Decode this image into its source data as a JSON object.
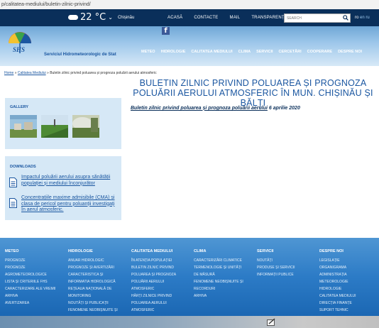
{
  "browser": {
    "url": "p/calitatea-mediului/buletin-zilnic-privind/"
  },
  "topbar": {
    "temperature": "22 °C",
    "chevron": "⌄",
    "city": "Chișinău",
    "links": [
      "ACASĂ",
      "CONTACTE",
      "MAIL",
      "TRANSPARENȚA"
    ],
    "search_placeholder": "SEARCH",
    "lang_active": "ro",
    "lang_other": "en ru"
  },
  "header": {
    "facebook": "f",
    "logo_text": "Serviciul Hidrometeorologic de Stat",
    "nav": [
      "METEO",
      "HIDROLOGIE",
      "CALITATEA MEDIULUI",
      "CLIMA",
      "SERVICII",
      "CERCETĂRI",
      "COOPERARE",
      "DESPRE NOI"
    ]
  },
  "breadcrumb": {
    "home": "Home",
    "sep1": " » ",
    "section": "Calitatea Mediului",
    "sep2": " » ",
    "current": "Buletin zilnic privind poluarea și prognoza poluării aerului atmosferic"
  },
  "main": {
    "title": "BULETIN ZILNIC PRIVIND POLUAREA ȘI PROGNOZA POLUĂRII AERULUI ATMOSFERIC ÎN MUN. CHIȘINĂU ȘI BĂLȚI",
    "doc_link": "Buletin zilnic privind poluarea și prognoza poluării aerului",
    "doc_date": "  6 aprilie 2020"
  },
  "gallery": {
    "heading": "GALLERY"
  },
  "downloads": {
    "heading": "DOWNLOADS",
    "items": [
      {
        "label": "Impactul poluării aerului asupra sănătății populației și mediului înconjurător"
      },
      {
        "label": "Concentrațiile maxime admisibile (CMA) și clasa de pericol pentru poluanții investigați în aerul atmosferic."
      }
    ]
  },
  "footer": {
    "columns": [
      {
        "heading": "METEO",
        "items": [
          "PROGNOZE",
          "PROGNOZE",
          "AGROMETEOROLOGICE",
          "LISTA ȘI CRITERIILE FHS",
          "CARACTERIZARE ALE VREMII",
          "ARHIVA",
          "AVERTIZAREA"
        ]
      },
      {
        "heading": "HIDROLOGIE",
        "items": [
          "ANUAR HIDROLOGIC",
          "PROGNOZE ȘI AVERTIZĂRI",
          "CARACTERISTICA ȘI",
          "INFORMATIA HIDROLOGICĂ",
          "REȚEAUA NAȚIONALĂ DE",
          "MONITORING",
          "NOUTĂȚI ȘI PUBLICAȚII",
          "FENOMENE NEOBIȘNUITE ȘI"
        ]
      },
      {
        "heading": "CALITATEA MEDIULUI",
        "items": [
          "ÎN ATENȚIA POPULAȚIEI",
          "BULETIN ZILNIC PRIVIND",
          "POLUAREA ȘI PROGNOZA",
          "POLUĂRII AERULUI",
          "ATMOSFERIC",
          "HĂRȚI ZILNICE PRIVIND",
          "POLUAREA AERULUI",
          "ATMOSFERIC"
        ]
      },
      {
        "heading": "CLIMA",
        "items": [
          "CARACTERIZĂRI CLIMATICE",
          "TERMENOLOGIE ȘI UNITĂȚI",
          "DE MĂSURĂ",
          "FENOMENE NEOBIȘNUITE ȘI",
          "RECORDURI",
          "ARHIVA"
        ]
      },
      {
        "heading": "SERVICII",
        "items": [
          "NOUTĂȚI",
          "PRODUSE ȘI SERVICII",
          "INFORMAȚII PUBLICE"
        ]
      },
      {
        "heading": "DESPRE NOI",
        "items": [
          "LEGISLAȚIE",
          "ORGANIGRAMA",
          "ADMINISTRAȚIA",
          "METEOROLOGIE",
          "HIDROLOGIE",
          "CALITATEA MEDIULUI",
          "DIRECȚIA FINANȚE",
          "SUPORT TEHNIC"
        ]
      }
    ]
  },
  "colors": {
    "topbar": "#0a2f5a",
    "accent": "#1a56a0",
    "sidebar": "#d6e8f6",
    "footer": "#2c7bc6"
  }
}
